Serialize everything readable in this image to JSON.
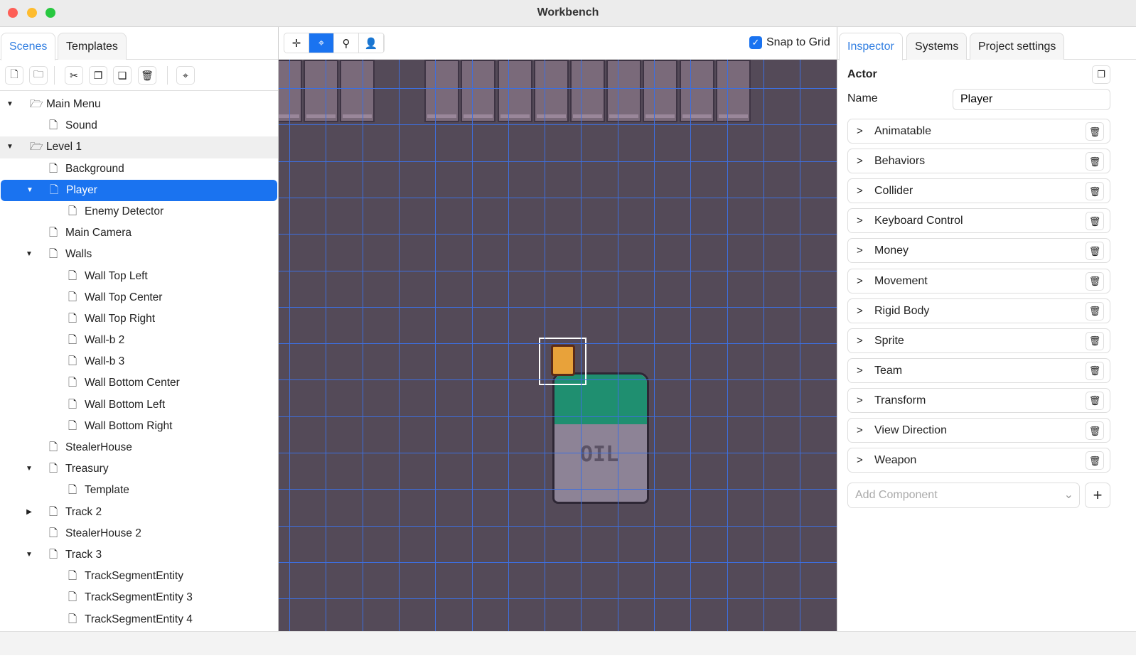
{
  "window": {
    "title": "Workbench"
  },
  "left": {
    "tabs": [
      "Scenes",
      "Templates"
    ],
    "toolbar": [
      "new-file-icon",
      "new-folder-icon",
      "scissors-icon",
      "copy-icon",
      "paste-icon",
      "trash-icon",
      "target-icon"
    ],
    "tree": [
      {
        "label": "Main Menu",
        "depth": 0,
        "arrow": "down",
        "icon": "folder-open"
      },
      {
        "label": "Sound",
        "depth": 1,
        "icon": "file"
      },
      {
        "label": "Level 1",
        "depth": 0,
        "arrow": "down",
        "icon": "folder-open",
        "highlight": true
      },
      {
        "label": "Background",
        "depth": 1,
        "icon": "file"
      },
      {
        "label": "Player",
        "depth": 1,
        "arrow": "down",
        "icon": "file",
        "selected": true
      },
      {
        "label": "Enemy Detector",
        "depth": 2,
        "icon": "file"
      },
      {
        "label": "Main Camera",
        "depth": 1,
        "icon": "file"
      },
      {
        "label": "Walls",
        "depth": 1,
        "arrow": "down",
        "icon": "file"
      },
      {
        "label": "Wall Top Left",
        "depth": 2,
        "icon": "file"
      },
      {
        "label": "Wall Top Center",
        "depth": 2,
        "icon": "file"
      },
      {
        "label": "Wall Top Right",
        "depth": 2,
        "icon": "file"
      },
      {
        "label": "Wall-b 2",
        "depth": 2,
        "icon": "file"
      },
      {
        "label": "Wall-b 3",
        "depth": 2,
        "icon": "file"
      },
      {
        "label": "Wall Bottom Center",
        "depth": 2,
        "icon": "file"
      },
      {
        "label": "Wall Bottom Left",
        "depth": 2,
        "icon": "file"
      },
      {
        "label": "Wall Bottom Right",
        "depth": 2,
        "icon": "file"
      },
      {
        "label": "StealerHouse",
        "depth": 1,
        "icon": "file"
      },
      {
        "label": "Treasury",
        "depth": 1,
        "arrow": "down",
        "icon": "file"
      },
      {
        "label": "Template",
        "depth": 2,
        "icon": "file"
      },
      {
        "label": "Track 2",
        "depth": 1,
        "arrow": "right",
        "icon": "file"
      },
      {
        "label": "StealerHouse 2",
        "depth": 1,
        "icon": "file"
      },
      {
        "label": "Track 3",
        "depth": 1,
        "arrow": "down",
        "icon": "file"
      },
      {
        "label": "TrackSegmentEntity",
        "depth": 2,
        "icon": "file"
      },
      {
        "label": "TrackSegmentEntity 3",
        "depth": 2,
        "icon": "file"
      },
      {
        "label": "TrackSegmentEntity 4",
        "depth": 2,
        "icon": "file"
      }
    ]
  },
  "viewport": {
    "tools": [
      "move-icon",
      "target-icon",
      "zoom-icon",
      "user-icon"
    ],
    "active_tool": 1,
    "snap_label": "Snap to Grid",
    "snap_checked": true
  },
  "right": {
    "tabs": [
      "Inspector",
      "Systems",
      "Project settings"
    ],
    "section": "Actor",
    "name_label": "Name",
    "name_value": "Player",
    "components": [
      "Animatable",
      "Behaviors",
      "Collider",
      "Keyboard Control",
      "Money",
      "Movement",
      "Rigid Body",
      "Sprite",
      "Team",
      "Transform",
      "View Direction",
      "Weapon"
    ],
    "add_placeholder": "Add Component",
    "add_button": "+"
  },
  "colors": {
    "accent": "#1a73f0",
    "canvas": "#544a58",
    "grid": "#3d6fe0"
  }
}
